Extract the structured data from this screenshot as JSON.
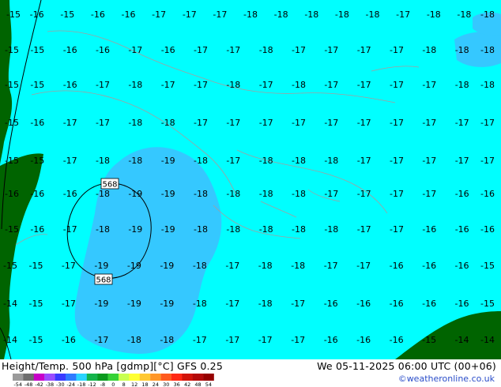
{
  "map": {
    "contour_label": "568",
    "contour_label_count": 2,
    "grid_label_rows": [
      {
        "row": 0,
        "values": [
          "-15",
          "-16",
          "-15",
          "-16",
          "-16",
          "-17",
          "-17",
          "-17",
          "-18",
          "-18",
          "-18",
          "-18",
          "-18",
          "-17",
          "-18",
          "-18",
          "-18"
        ]
      },
      {
        "row": 1,
        "values": [
          "-15",
          "-15",
          "-16",
          "-16",
          "-17",
          "-16",
          "-17",
          "-17",
          "-18",
          "-17",
          "-17",
          "-17",
          "-17",
          "-18",
          "-18",
          "-18"
        ]
      },
      {
        "row": 2,
        "values": [
          "-15",
          "-15",
          "-16",
          "-17",
          "-18",
          "-17",
          "-17",
          "-18",
          "-17",
          "-18",
          "-17",
          "-17",
          "-17",
          "-17",
          "-18",
          "-18"
        ]
      },
      {
        "row": 3,
        "values": [
          "-15",
          "-16",
          "-17",
          "-17",
          "-18",
          "-18",
          "-17",
          "-17",
          "-17",
          "-17",
          "-17",
          "-17",
          "-17",
          "-17",
          "-17",
          "-17"
        ]
      },
      {
        "row": 4,
        "values": [
          "-15",
          "-15",
          "-17",
          "-18",
          "-18",
          "-19",
          "-18",
          "-17",
          "-18",
          "-18",
          "-18",
          "-17",
          "-17",
          "-17",
          "-17",
          "-17"
        ]
      },
      {
        "row": 5,
        "values": [
          "-16",
          "-16",
          "-16",
          "-18",
          "-19",
          "-19",
          "-18",
          "-18",
          "-18",
          "-18",
          "-17",
          "-17",
          "-17",
          "-17",
          "-16",
          "-16"
        ]
      },
      {
        "row": 6,
        "values": [
          "-15",
          "-16",
          "-17",
          "-18",
          "-19",
          "-19",
          "-18",
          "-18",
          "-18",
          "-18",
          "-18",
          "-17",
          "-17",
          "-16",
          "-16",
          "-16"
        ]
      },
      {
        "row": 7,
        "values": [
          "-15",
          "-15",
          "-17",
          "-19",
          "-19",
          "-19",
          "-18",
          "-17",
          "-18",
          "-18",
          "-17",
          "-17",
          "-16",
          "-16",
          "-16",
          "-15"
        ]
      },
      {
        "row": 8,
        "values": [
          "-14",
          "-15",
          "-17",
          "-19",
          "-19",
          "-19",
          "-18",
          "-17",
          "-18",
          "-17",
          "-16",
          "-16",
          "-16",
          "-16",
          "-16",
          "-15"
        ]
      },
      {
        "row": 9,
        "values": [
          "-14",
          "-15",
          "-16",
          "-17",
          "-18",
          "-18",
          "-17",
          "-17",
          "-17",
          "-17",
          "-16",
          "-16",
          "-16",
          "-15",
          "-14",
          "-14"
        ]
      }
    ]
  },
  "footer": {
    "title_left": "Height/Temp. 500 hPa [gdmp][°C] GFS 0.25",
    "title_right": "We 05-11-2025 06:00 UTC (00+06)",
    "credit": "©weatheronline.co.uk",
    "scale_labels": [
      "-54",
      "-48",
      "-42",
      "-38",
      "-30",
      "-24",
      "-18",
      "-12",
      "-8",
      "0",
      "8",
      "12",
      "18",
      "24",
      "30",
      "36",
      "42",
      "48",
      "54"
    ],
    "scale_colors": [
      "#9b9b9b",
      "#6e6e6e",
      "#c800c8",
      "#9b4bff",
      "#3a3aff",
      "#2f7bff",
      "#2ad4ff",
      "#14b44b",
      "#0a9a1e",
      "#36d236",
      "#c8ff50",
      "#ffff32",
      "#ffc832",
      "#ff9628",
      "#ff5a1e",
      "#ff2814",
      "#d2140a",
      "#b40a0a",
      "#960000"
    ]
  },
  "colors": {
    "sea_cyan": "#00ffff",
    "cold_blue": "#35c8ff",
    "land_green": "#006400",
    "coast_gray": "#a0a0a0"
  }
}
